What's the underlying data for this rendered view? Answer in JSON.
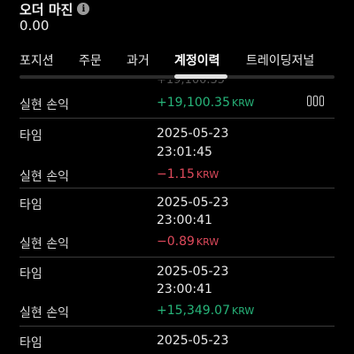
{
  "header": {
    "order_margin_label": "오더 마진",
    "order_margin_value": "0.00"
  },
  "tabs": [
    {
      "label": "포지션"
    },
    {
      "label": "주문"
    },
    {
      "label": "과거"
    },
    {
      "label": "계정이력"
    },
    {
      "label": "트레이딩저널"
    }
  ],
  "active_tab": "계정이력",
  "labels": {
    "time": "타임",
    "realized_pnl": "실현 손익"
  },
  "records": [
    {
      "pnl": "+19,100.35",
      "unit": "KRW",
      "sign": "positive"
    },
    {
      "date": "2025-05-23",
      "time": "23:01:45",
      "pnl": "−1.15",
      "unit": "KRW",
      "sign": "negative"
    },
    {
      "date": "2025-05-23",
      "time": "23:00:41",
      "pnl": "−0.89",
      "unit": "KRW",
      "sign": "negative"
    },
    {
      "date": "2025-05-23",
      "time": "23:00:41",
      "pnl": "+15,349.07",
      "unit": "KRW",
      "sign": "positive"
    },
    {
      "date": "2025-05-23"
    }
  ],
  "colors": {
    "positive": "#27b57a",
    "negative": "#e04a5c",
    "background": "#000000"
  }
}
